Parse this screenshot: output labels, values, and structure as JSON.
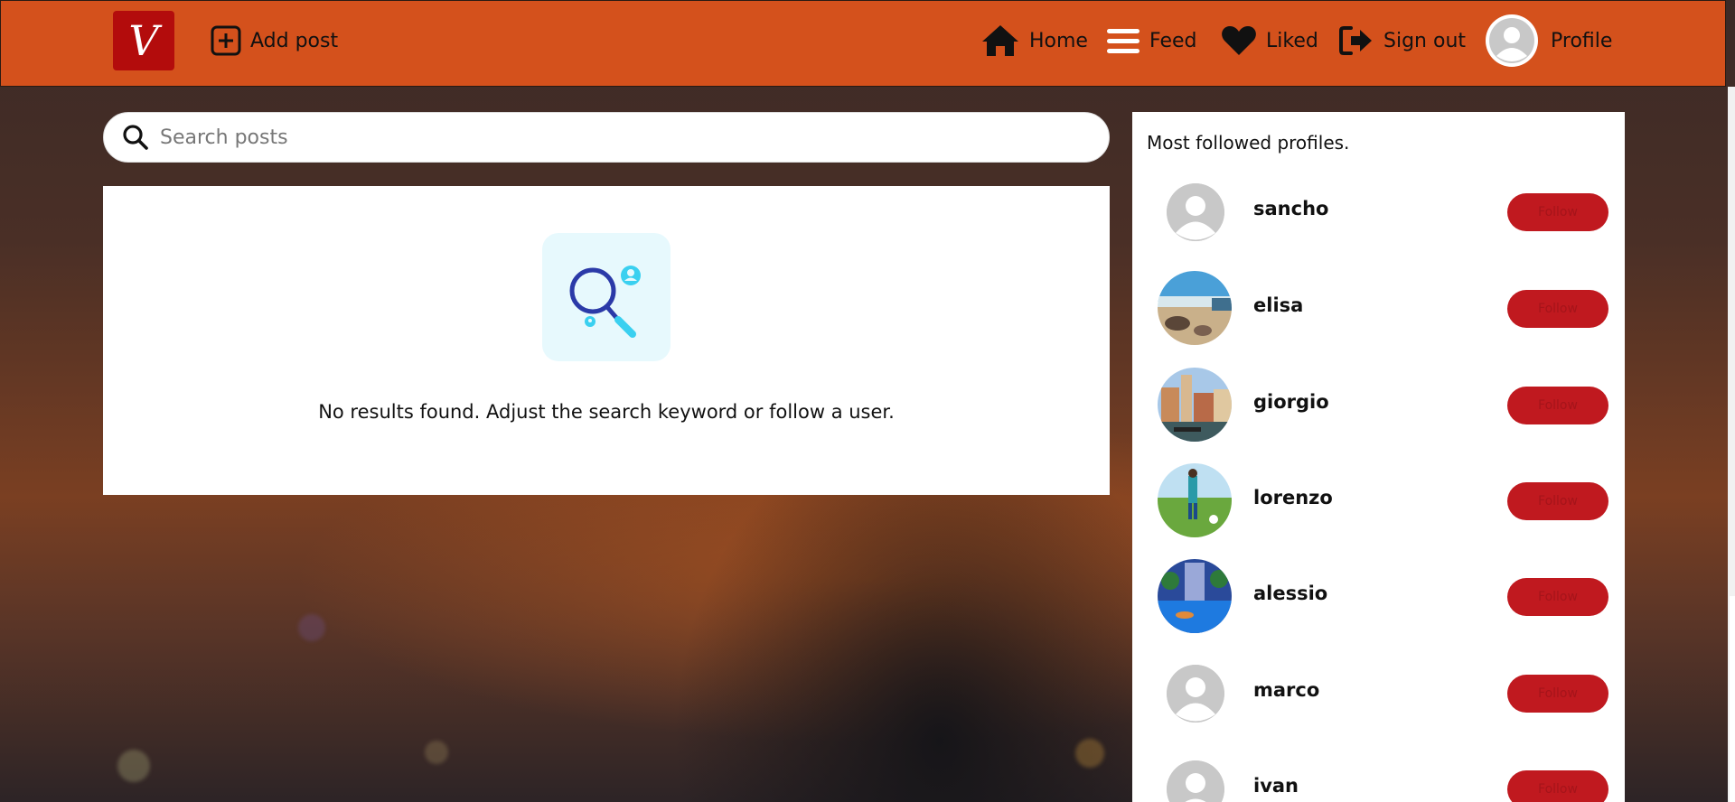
{
  "navbar": {
    "logo_text": "V",
    "add_post": "Add post",
    "home": "Home",
    "feed": "Feed",
    "liked": "Liked",
    "sign_out": "Sign out",
    "profile": "Profile",
    "accent_color": "#d4511c"
  },
  "search": {
    "placeholder": "Search posts",
    "value": ""
  },
  "results": {
    "empty_message": "No results found. Adjust the search keyword or follow a user."
  },
  "sidebar": {
    "title": "Most followed profiles.",
    "follow_label": "Follow",
    "profiles": [
      {
        "name": "sancho",
        "avatar": "default"
      },
      {
        "name": "elisa",
        "avatar": "beach-photo"
      },
      {
        "name": "giorgio",
        "avatar": "venice-photo"
      },
      {
        "name": "lorenzo",
        "avatar": "football-field-photo"
      },
      {
        "name": "alessio",
        "avatar": "pool-photo"
      },
      {
        "name": "marco",
        "avatar": "default"
      },
      {
        "name": "ivan",
        "avatar": "default"
      }
    ]
  }
}
